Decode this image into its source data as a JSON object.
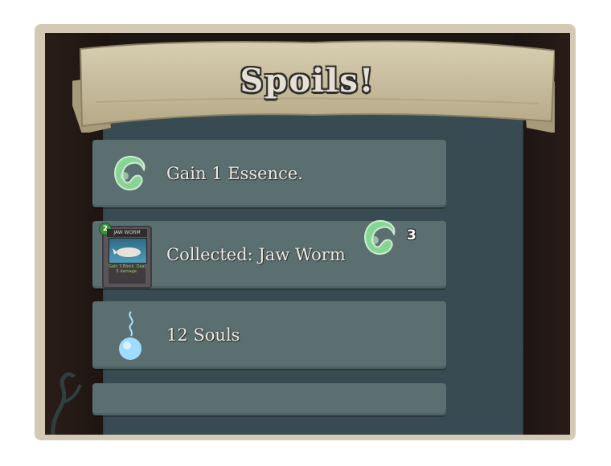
{
  "screen": {
    "title": "Spoils!",
    "colors": {
      "frame": "#d3c9b4",
      "panel": "#394b52",
      "row": "#5b6f71",
      "essence": "#7fd08a",
      "soul": "#9fe0ff",
      "banner": "#c8bd9e"
    }
  },
  "rewards": [
    {
      "icon": "essence-icon",
      "label": "Gain 1 Essence."
    },
    {
      "icon": "card-icon",
      "label": "Collected: Jaw Worm",
      "card": {
        "name": "JAW WORM",
        "cost": "2",
        "text": "Gain 3 Block. Deal 5 damage."
      },
      "essence_reward": {
        "icon": "essence-icon",
        "count": "3"
      }
    },
    {
      "icon": "soul-icon",
      "label": "12 Souls"
    }
  ]
}
